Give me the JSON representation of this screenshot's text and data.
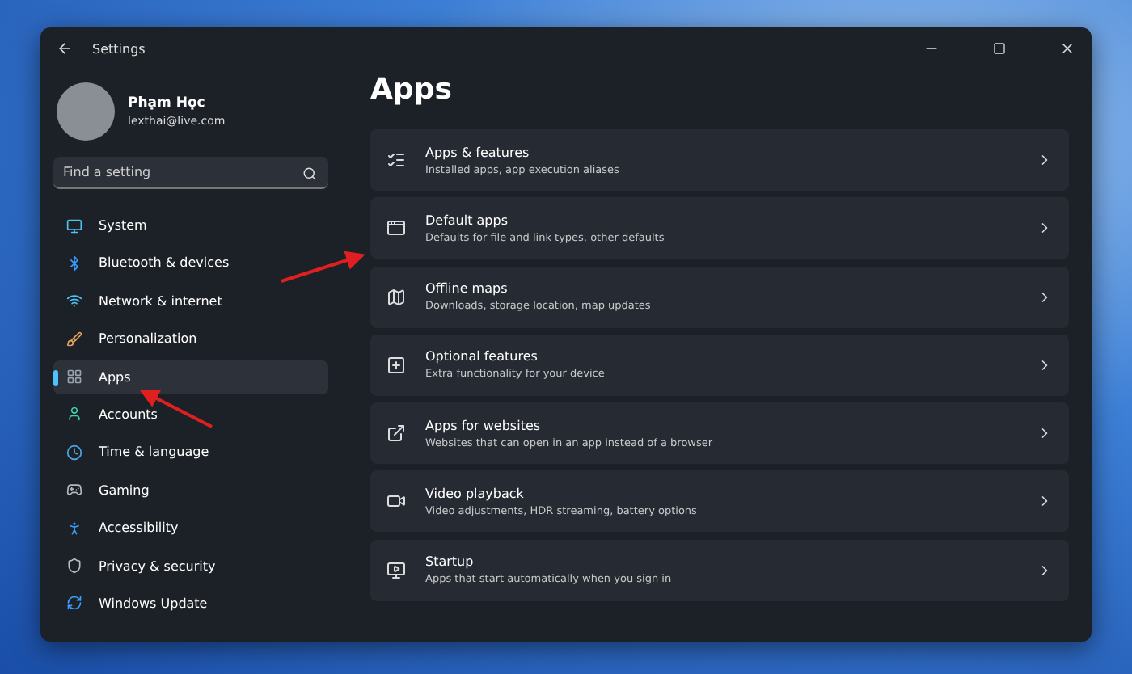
{
  "window": {
    "title": "Settings"
  },
  "account": {
    "name": "Phạm Học",
    "email": "lexthai@live.com"
  },
  "search": {
    "placeholder": "Find a setting"
  },
  "sidebar": {
    "items": [
      {
        "label": "System",
        "selected": false
      },
      {
        "label": "Bluetooth & devices",
        "selected": false
      },
      {
        "label": "Network & internet",
        "selected": false
      },
      {
        "label": "Personalization",
        "selected": false
      },
      {
        "label": "Apps",
        "selected": true
      },
      {
        "label": "Accounts",
        "selected": false
      },
      {
        "label": "Time & language",
        "selected": false
      },
      {
        "label": "Gaming",
        "selected": false
      },
      {
        "label": "Accessibility",
        "selected": false
      },
      {
        "label": "Privacy & security",
        "selected": false
      },
      {
        "label": "Windows Update",
        "selected": false
      }
    ]
  },
  "page": {
    "title": "Apps",
    "items": [
      {
        "title": "Apps & features",
        "description": "Installed apps, app execution aliases"
      },
      {
        "title": "Default apps",
        "description": "Defaults for file and link types, other defaults"
      },
      {
        "title": "Offline maps",
        "description": "Downloads, storage location, map updates"
      },
      {
        "title": "Optional features",
        "description": "Extra functionality for your device"
      },
      {
        "title": "Apps for websites",
        "description": "Websites that can open in an app instead of a browser"
      },
      {
        "title": "Video playback",
        "description": "Video adjustments, HDR streaming, battery options"
      },
      {
        "title": "Startup",
        "description": "Apps that start automatically when you sign in"
      }
    ]
  }
}
